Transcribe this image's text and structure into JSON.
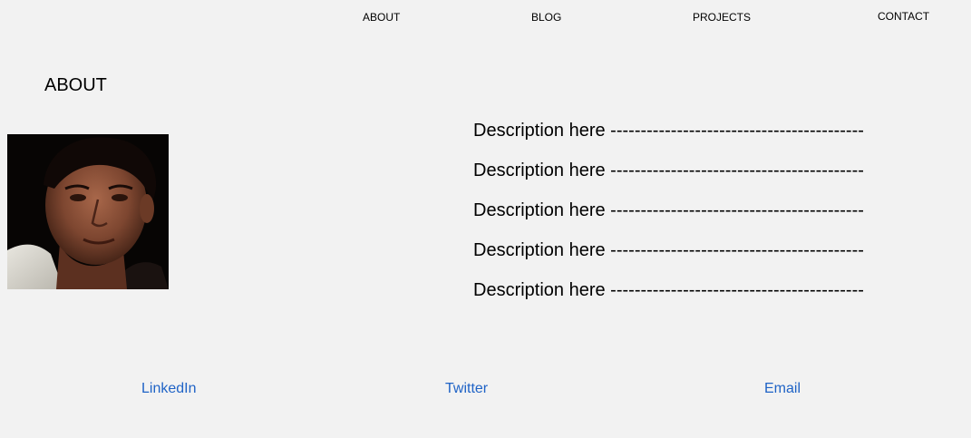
{
  "nav": {
    "about": "ABOUT",
    "blog": "BLOG",
    "projects": "PROJECTS",
    "contact": "CONTACT"
  },
  "about": {
    "heading": "ABOUT",
    "descriptions": [
      "Description here ------------------------------------------",
      "Description here ------------------------------------------",
      "Description here ------------------------------------------",
      "Description here ------------------------------------------",
      "Description here ------------------------------------------"
    ]
  },
  "social": {
    "linkedin": "LinkedIn",
    "twitter": "Twitter",
    "email": "Email"
  },
  "colors": {
    "background": "#f2f2f2",
    "link": "#1f63c6"
  }
}
